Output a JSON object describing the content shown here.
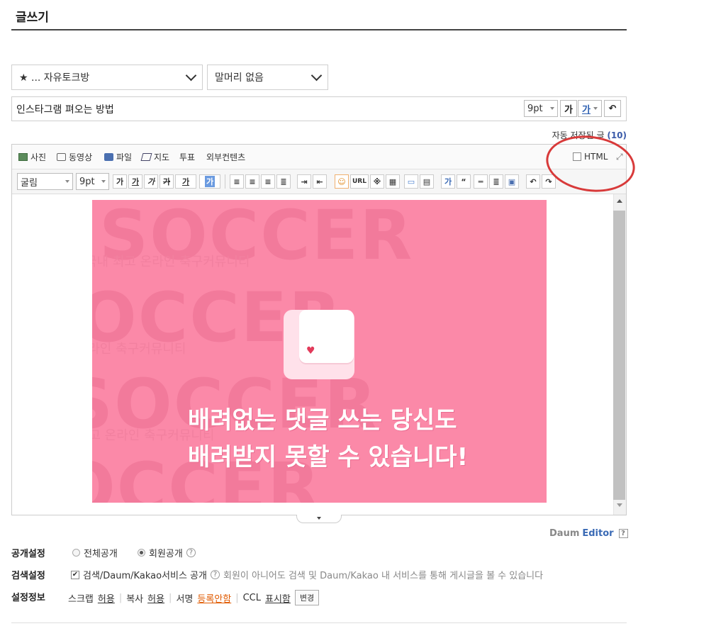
{
  "page": {
    "title": "글쓰기"
  },
  "board_select": {
    "value": "★ ... 자유토크방"
  },
  "prefix_select": {
    "value": "말머리 없음"
  },
  "subject": {
    "value": "인스타그램 펴오는 방법",
    "font_size": "9pt",
    "bold": "가",
    "underline": "가"
  },
  "autosave": {
    "label": "자동 저장된 글",
    "count": "(10)"
  },
  "toolbar1": {
    "photo": "사진",
    "video": "동영상",
    "file": "파일",
    "map": "지도",
    "poll": "투표",
    "external": "외부컨텐츠",
    "html_label": "HTML"
  },
  "toolbar2": {
    "font": "굴림",
    "size": "9pt",
    "bold": "가",
    "underline": "가",
    "italic": "가",
    "strike": "가",
    "fontcolor": "가",
    "bgcolor": "가",
    "url": "URL",
    "special": "※",
    "quote": "“",
    "textbox": "가"
  },
  "image": {
    "bg_word": "SOCCER",
    "bg_text": "국내 최고 온라인 축구커뮤니티",
    "line1": "배려없는 댓글 쓰는 당신도",
    "line2": "배려받지 못할 수 있습니다!"
  },
  "editor_brand": {
    "daum": "Daum",
    "editor": "Editor",
    "help": "?"
  },
  "settings": {
    "public": {
      "label": "공개설정",
      "opt_all": "전체공개",
      "opt_member": "회원공개",
      "selected": "회원공개",
      "help": "?"
    },
    "search": {
      "label": "검색설정",
      "check_label": "검색/Daum/Kakao서비스 공개",
      "checked": true,
      "help": "?",
      "desc": "회원이 아니어도 검색 및 Daum/Kakao 내 서비스를 통해 게시글을 볼 수 있습니다"
    },
    "info": {
      "label": "설정정보",
      "scrap": "스크랩",
      "scrap_val": "허용",
      "copy": "복사",
      "copy_val": "허용",
      "sign": "서명",
      "sign_val": "등록안함",
      "ccl": "CCL",
      "ccl_val": "표시함",
      "change": "변경"
    }
  },
  "colors": {
    "image_bg": "#fb89a8",
    "annotation": "#d83a3a",
    "editor_link": "#3a6ab5",
    "warning_link": "#e05a00"
  }
}
